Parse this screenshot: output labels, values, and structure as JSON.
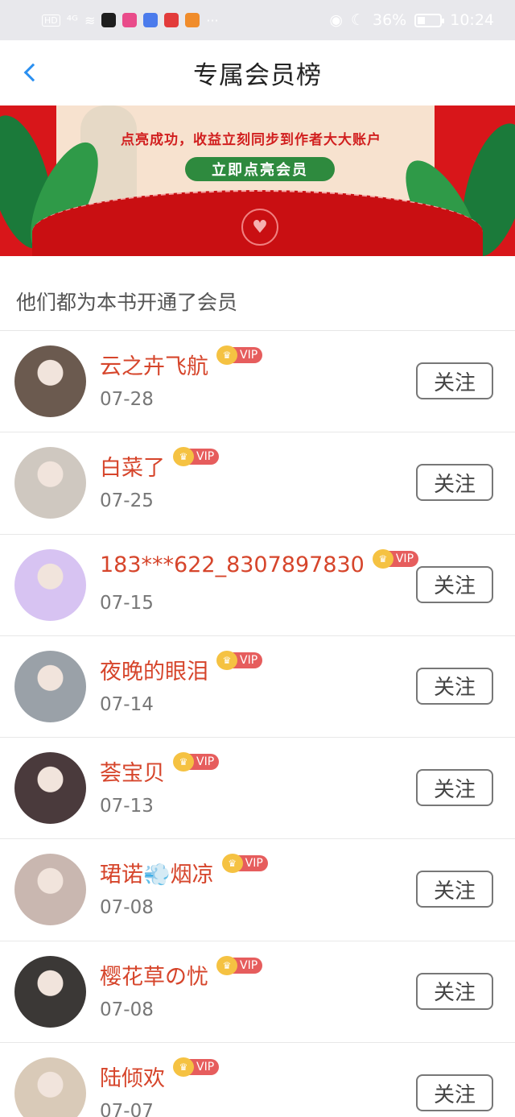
{
  "status_bar": {
    "hd": "HD",
    "signal": "⁴ᴳ",
    "battery_percent": "36%",
    "time": "10:24",
    "more": "···",
    "battery_level": 0.36
  },
  "header": {
    "title": "专属会员榜"
  },
  "banner": {
    "caption": "点亮成功，收益立刻同步到作者大大账户",
    "cta": "立即点亮会员"
  },
  "section": {
    "title": "他们都为本书开通了会员"
  },
  "vip_label": "VIP",
  "follow_label": "关注",
  "members": [
    {
      "name": "云之卉飞航",
      "date": "07-28",
      "avatar_color": "#6b5a4f"
    },
    {
      "name": "白菜了",
      "date": "07-25",
      "avatar_color": "#cfc8c0"
    },
    {
      "name": "183***622_8307897830",
      "date": "07-15",
      "avatar_color": "#d7c3f2"
    },
    {
      "name": "夜晚的眼泪",
      "date": "07-14",
      "avatar_color": "#9aa1a8"
    },
    {
      "name": "荟宝贝",
      "date": "07-13",
      "avatar_color": "#4a3a3c"
    },
    {
      "name": "珺诺💨烟凉",
      "date": "07-08",
      "avatar_color": "#c9b7b0"
    },
    {
      "name": "樱花草の忧",
      "date": "07-08",
      "avatar_color": "#3b3836"
    },
    {
      "name": "陆倾欢",
      "date": "07-07",
      "avatar_color": "#d9cab8"
    }
  ]
}
